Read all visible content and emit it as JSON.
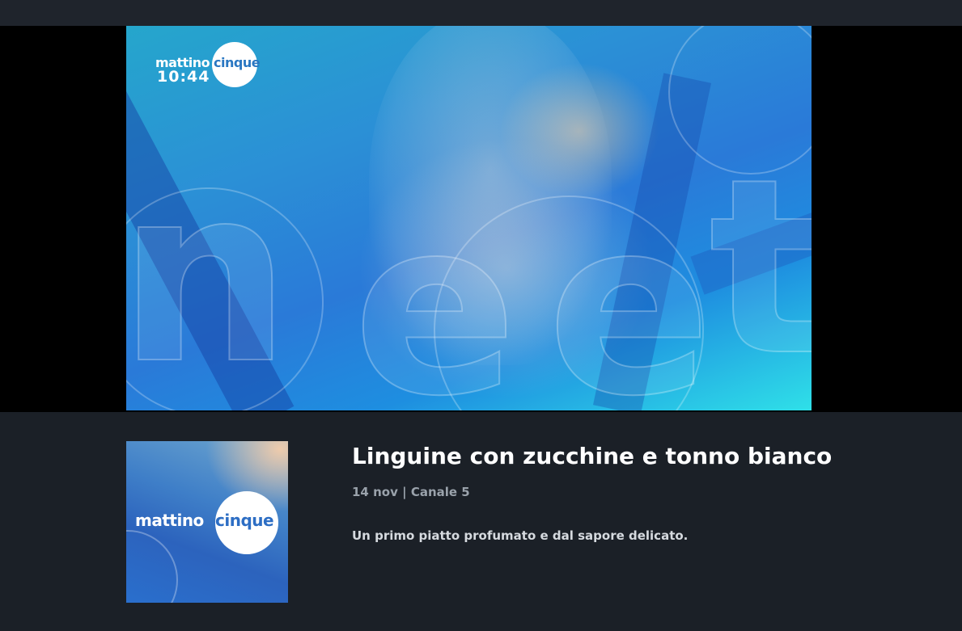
{
  "video": {
    "logo_brand": "mattino",
    "logo_brand_accent": "cinque",
    "clock": "10:44"
  },
  "program": {
    "thumbnail_brand": "mattino",
    "thumbnail_brand_accent": "cinque",
    "title": "Linguine con zucchine e tonno bianco",
    "date": "14 nov",
    "separator": "|",
    "channel": "Canale 5",
    "description": "Un primo piatto profumato e dal sapore delicato."
  },
  "colors": {
    "background": "#1b2027",
    "top_bar": "#1f242c",
    "player_band": "#000000",
    "title": "#ffffff",
    "meta": "#9aa2ab",
    "description": "#d6dadf"
  }
}
